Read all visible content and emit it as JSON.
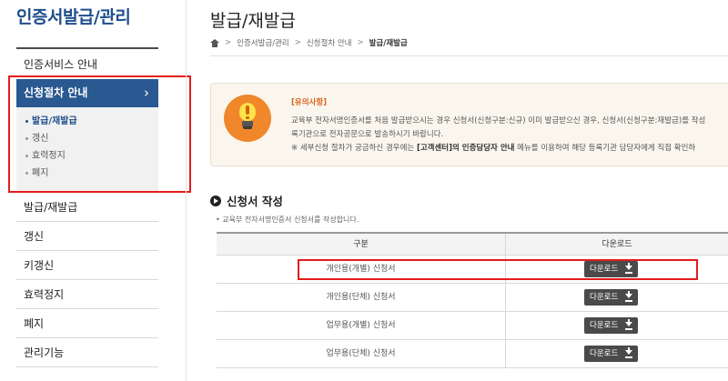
{
  "sidebar": {
    "title": "인증서발급/관리",
    "items_top": [
      "인증서비스 안내"
    ],
    "active_item": "신청절차 안내",
    "active_chevron": "›",
    "submenu": [
      {
        "label": "발급/재발급",
        "active": true
      },
      {
        "label": "갱신",
        "active": false
      },
      {
        "label": "효력정지",
        "active": false
      },
      {
        "label": "폐지",
        "active": false
      }
    ],
    "items_bottom": [
      "발급/재발급",
      "갱신",
      "키갱신",
      "효력정지",
      "폐지",
      "관리기능"
    ]
  },
  "main": {
    "title": "발급/재발급",
    "breadcrumb": [
      "인증서발급/관리",
      "신청절차 안내",
      "발급/재발급"
    ],
    "home_icon": "home-icon",
    "notice": {
      "heading": "[유의사항]",
      "line1": "교육부 전자서명인증서를 처음 발급받으시는 경우 신청서(신청구분:신규) 이미 발급받으신 경우, 신청서(신청구분:재발급)를 작성",
      "line2": "록기관으로 전자공문으로 발송하시기 바랍니다.",
      "line3_prefix": "※ 세부신청 절차가 궁금하신 경우에는 ",
      "line3_bold": "[고객센터]의 인증담당자 안내",
      "line3_suffix": " 메뉴를 이용하여 해당 등록기관 담당자에게 직접 확인하",
      "icon": "lightbulb-icon"
    },
    "section": {
      "title": "신청서 작성",
      "desc": "• 교육부 전자서명인증서 신청서를 작성합니다."
    },
    "table": {
      "headers": [
        "구분",
        "다운로드"
      ],
      "download_label": "다운로드",
      "rows": [
        {
          "name": "개인용(개별) 신청서"
        },
        {
          "name": "개인용(단체) 신청서"
        },
        {
          "name": "업무용(개별) 신청서"
        },
        {
          "name": "업무용(단체) 신청서"
        }
      ]
    }
  },
  "colors": {
    "brand_blue": "#2a5891",
    "title_blue": "#1f4e8c",
    "highlight_red": "#e31c1c",
    "notice_orange": "#f0872a",
    "button_dark": "#4a4a4a"
  }
}
